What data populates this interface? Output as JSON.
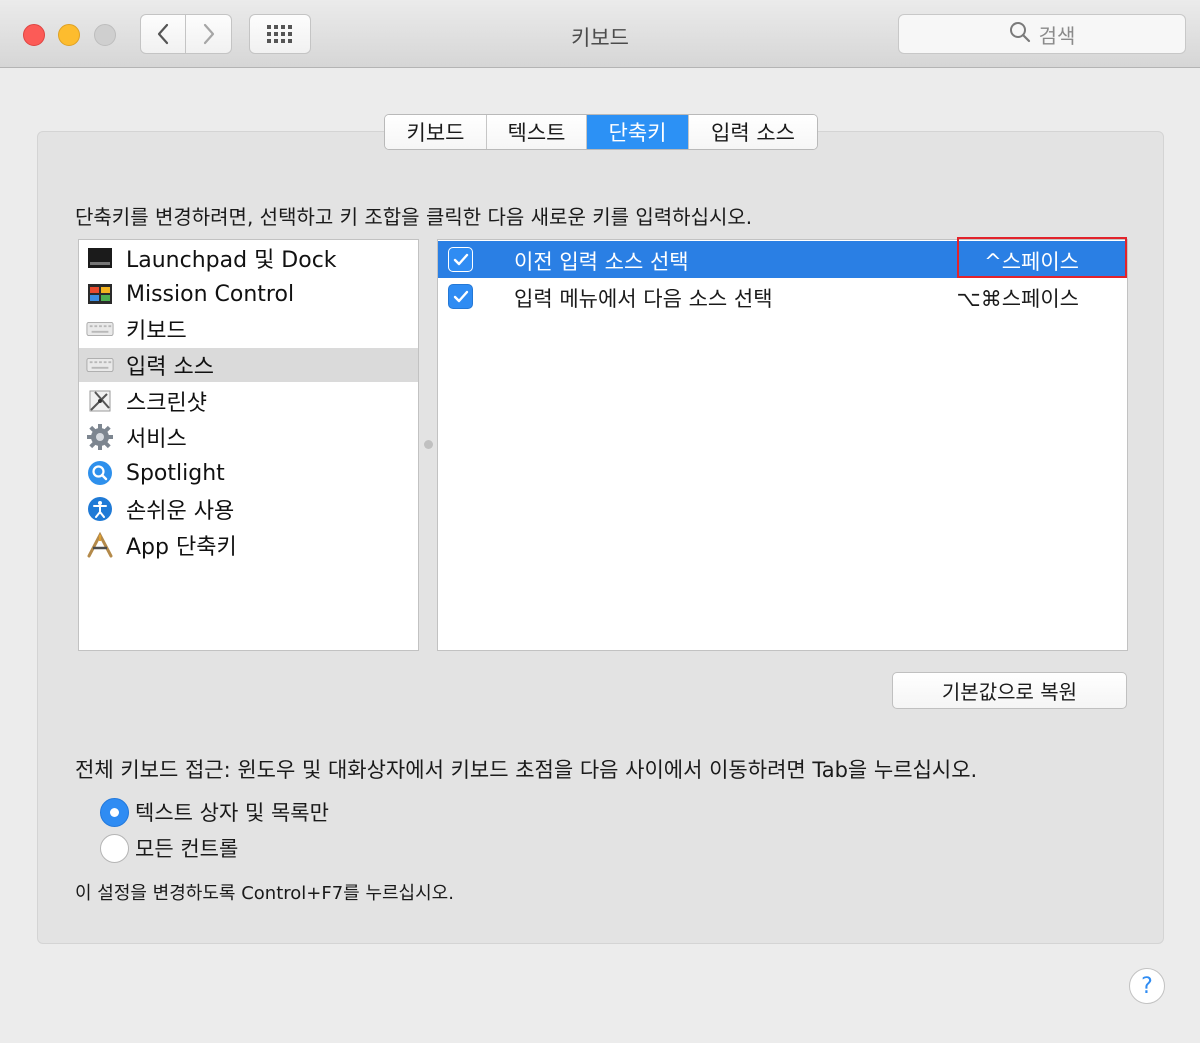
{
  "window": {
    "title": "키보드",
    "search_placeholder": "검색"
  },
  "tabs": [
    {
      "label": "키보드",
      "active": false
    },
    {
      "label": "텍스트",
      "active": false
    },
    {
      "label": "단축키",
      "active": true
    },
    {
      "label": "입력 소스",
      "active": false
    }
  ],
  "instruction": "단축키를 변경하려면, 선택하고 키 조합을 클릭한 다음 새로운 키를 입력하십시오.",
  "categories": [
    {
      "label": "Launchpad 및 Dock",
      "icon": "launchpad-dock-icon"
    },
    {
      "label": "Mission Control",
      "icon": "mission-control-icon"
    },
    {
      "label": "키보드",
      "icon": "keyboard-icon"
    },
    {
      "label": "입력 소스",
      "icon": "input-source-keyboard-icon",
      "selected": true
    },
    {
      "label": "스크린샷",
      "icon": "screenshot-icon"
    },
    {
      "label": "서비스",
      "icon": "services-gear-icon"
    },
    {
      "label": "Spotlight",
      "icon": "spotlight-icon"
    },
    {
      "label": "손쉬운 사용",
      "icon": "accessibility-icon"
    },
    {
      "label": "App 단축키",
      "icon": "app-shortcuts-icon"
    }
  ],
  "shortcuts": [
    {
      "name": "이전 입력 소스 선택",
      "key": "^스페이스",
      "checked": true,
      "selected": true
    },
    {
      "name": "입력 메뉴에서 다음 소스 선택",
      "key": "⌥⌘스페이스",
      "checked": true,
      "selected": false
    }
  ],
  "restore_button": "기본값으로 복원",
  "full_keyboard_access": {
    "label": "전체 키보드 접근: 윈도우 및 대화상자에서 키보드 초점을 다음 사이에서 이동하려면 Tab을 누르십시오.",
    "options": [
      {
        "label": "텍스트 상자 및 목록만",
        "selected": true
      },
      {
        "label": "모든 컨트롤",
        "selected": false
      }
    ],
    "hint": "이 설정을 변경하도록 Control+F7를 누르십시오."
  },
  "help_label": "?",
  "colors": {
    "accent": "#2c91f5",
    "selection": "#2a7fe4",
    "highlight_border": "#e2232b"
  }
}
